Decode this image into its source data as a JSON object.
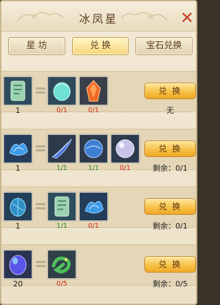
{
  "title": "冰凤星",
  "close_label": "✕",
  "tabs": [
    {
      "label": "星 坊",
      "active": false
    },
    {
      "label": "兑 换",
      "active": true
    },
    {
      "label": "宝石兑换",
      "active": false
    }
  ],
  "rows": [
    {
      "target": {
        "icon": "jade-tablet-icon",
        "count": "1"
      },
      "materials": [
        {
          "icon": "cyan-crystal-icon",
          "count": "0/1",
          "status": "red"
        },
        {
          "icon": "red-gem-icon",
          "count": "0/1",
          "status": "red"
        }
      ],
      "button": "兑 换",
      "remain": "无"
    },
    {
      "target": {
        "icon": "blue-flame-icon",
        "count": "1"
      },
      "materials": [
        {
          "icon": "blue-feather-icon",
          "count": "1/1",
          "status": "green"
        },
        {
          "icon": "blue-orb-icon",
          "count": "1/1",
          "status": "green"
        },
        {
          "icon": "pearl-orb-icon",
          "count": "0/1",
          "status": "red"
        }
      ],
      "button": "兑 换",
      "remain": "剩余：0/1"
    },
    {
      "target": {
        "icon": "blue-crystal-icon",
        "count": "1"
      },
      "materials": [
        {
          "icon": "jade-tablet-icon",
          "count": "1/1",
          "status": "green"
        },
        {
          "icon": "blue-flame-icon",
          "count": "0/1",
          "status": "red"
        }
      ],
      "button": "兑 换",
      "remain": "剩余：0/1"
    },
    {
      "target": {
        "icon": "purple-egg-icon",
        "count": "20"
      },
      "materials": [
        {
          "icon": "green-dragon-icon",
          "count": "0/5",
          "status": "red"
        }
      ],
      "button": "兑 换",
      "remain": "剩余：0/5"
    }
  ]
}
